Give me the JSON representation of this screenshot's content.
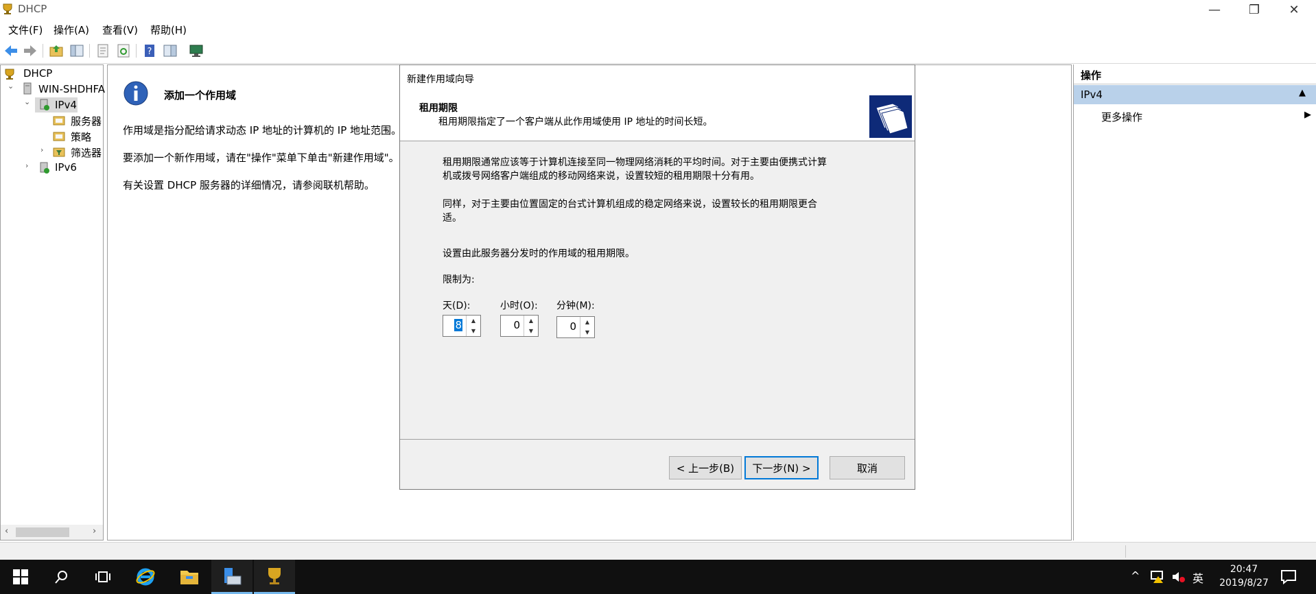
{
  "window": {
    "title": "DHCP",
    "minimize": "—",
    "restore": "❐",
    "close": "✕"
  },
  "menu": [
    "文件(F)",
    "操作(A)",
    "查看(V)",
    "帮助(H)"
  ],
  "tree": {
    "root": "DHCP",
    "server": "WIN-SHDHFA",
    "ipv4": "IPv4",
    "ipv4_children": [
      "服务器",
      "策略",
      "筛选器"
    ],
    "ipv6": "IPv6"
  },
  "content": {
    "heading": "添加一个作用域",
    "lines": [
      "作用域是指分配给请求动态 IP 地址的计算机的 IP 地址范围。你",
      "要添加一个新作用域，请在\"操作\"菜单下单击\"新建作用域\"。",
      "有关设置 DHCP 服务器的详细情况，请参阅联机帮助。"
    ]
  },
  "dialog": {
    "title": "新建作用域向导",
    "section_title": "租用期限",
    "section_desc": "租用期限指定了一个客户端从此作用域使用 IP 地址的时间长短。",
    "para1_line1": "租用期限通常应该等于计算机连接至同一物理网络消耗的平均时间。对于主要由便携式计算",
    "para1_line2": "机或拨号网络客户端组成的移动网络来说，设置较短的租用期限十分有用。",
    "para2_line1": "同样，对于主要由位置固定的台式计算机组成的稳定网络来说，设置较长的租用期限更合",
    "para2_line2": "适。",
    "instruction": "设置由此服务器分发时的作用域的租用期限。",
    "limit_label": "限制为:",
    "days_label": "天(D):",
    "days_value": "8",
    "hours_label": "小时(O):",
    "hours_value": "0",
    "minutes_label": "分钟(M):",
    "minutes_value": "0",
    "back_button": "< 上一步(B)",
    "next_button": "下一步(N) >",
    "cancel_button": "取消"
  },
  "actions": {
    "header": "操作",
    "section": "IPv4",
    "more": "更多操作"
  },
  "taskbar": {
    "ime": "英",
    "time": "20:47",
    "date": "2019/8/27"
  },
  "colors": {
    "accent": "#0078d7",
    "action_section": "#b9d1ea",
    "taskbar": "#101010"
  }
}
